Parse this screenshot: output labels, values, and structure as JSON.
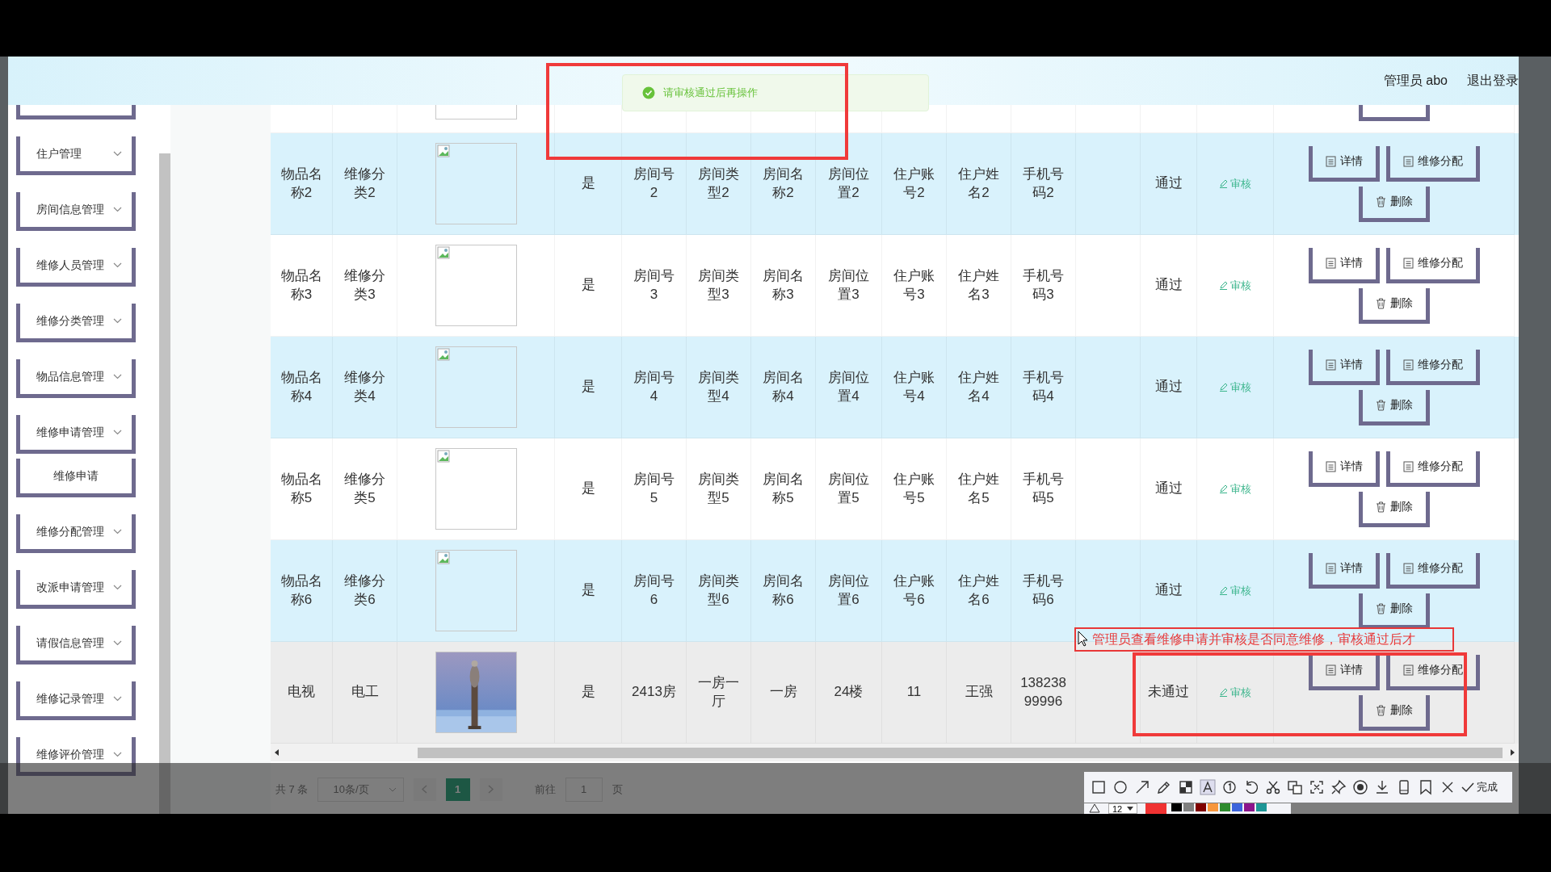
{
  "header": {
    "user": "管理员 abo",
    "logout": "退出登录"
  },
  "toast": {
    "message": "请审核通过后再操作"
  },
  "sidebar": {
    "items": [
      {
        "label": "住户管理",
        "kind": "group"
      },
      {
        "label": "房间信息管理",
        "kind": "group"
      },
      {
        "label": "维修人员管理",
        "kind": "group"
      },
      {
        "label": "维修分类管理",
        "kind": "group"
      },
      {
        "label": "物品信息管理",
        "kind": "group"
      },
      {
        "label": "维修申请管理",
        "kind": "group"
      },
      {
        "label": "维修申请",
        "kind": "sub"
      },
      {
        "label": "维修分配管理",
        "kind": "group"
      },
      {
        "label": "改派申请管理",
        "kind": "group"
      },
      {
        "label": "请假信息管理",
        "kind": "group"
      },
      {
        "label": "维修记录管理",
        "kind": "group"
      },
      {
        "label": "维修评价管理",
        "kind": "group"
      }
    ]
  },
  "table": {
    "rows": [
      {
        "cells": [
          "物品名称2",
          "维修分类2"
        ],
        "image": {
          "kind": "broken"
        },
        "details": [
          "是",
          "房间号2",
          "房间类型2",
          "房间名称2",
          "房间位置2",
          "住户账号2",
          "住户姓名2",
          "手机号码2"
        ],
        "status": "通过",
        "audit": "审核",
        "actions": [
          "详情",
          "维修分配",
          "删除"
        ],
        "hovered": false
      },
      {
        "cells": [
          "物品名称3",
          "维修分类3"
        ],
        "image": {
          "kind": "broken"
        },
        "details": [
          "是",
          "房间号3",
          "房间类型3",
          "房间名称3",
          "房间位置3",
          "住户账号3",
          "住户姓名3",
          "手机号码3"
        ],
        "status": "通过",
        "audit": "审核",
        "actions": [
          "详情",
          "维修分配",
          "删除"
        ],
        "hovered": false
      },
      {
        "cells": [
          "物品名称4",
          "维修分类4"
        ],
        "image": {
          "kind": "broken"
        },
        "details": [
          "是",
          "房间号4",
          "房间类型4",
          "房间名称4",
          "房间位置4",
          "住户账号4",
          "住户姓名4",
          "手机号码4"
        ],
        "status": "通过",
        "audit": "审核",
        "actions": [
          "详情",
          "维修分配",
          "删除"
        ],
        "hovered": false
      },
      {
        "cells": [
          "物品名称5",
          "维修分类5"
        ],
        "image": {
          "kind": "broken"
        },
        "details": [
          "是",
          "房间号5",
          "房间类型5",
          "房间名称5",
          "房间位置5",
          "住户账号5",
          "住户姓名5",
          "手机号码5"
        ],
        "status": "通过",
        "audit": "审核",
        "actions": [
          "详情",
          "维修分配",
          "删除"
        ],
        "hovered": false
      },
      {
        "cells": [
          "物品名称6",
          "维修分类6"
        ],
        "image": {
          "kind": "broken"
        },
        "details": [
          "是",
          "房间号6",
          "房间类型6",
          "房间名称6",
          "房间位置6",
          "住户账号6",
          "住户姓名6",
          "手机号码6"
        ],
        "status": "通过",
        "audit": "审核",
        "actions": [
          "详情",
          "维修分配",
          "删除"
        ],
        "hovered": false
      },
      {
        "cells": [
          "电视",
          "电工"
        ],
        "image": {
          "kind": "picture"
        },
        "details": [
          "是",
          "2413房",
          "一房一厅",
          "一房",
          "24楼",
          "11",
          "王强",
          "13823899996"
        ],
        "status": "未通过",
        "audit": "审核",
        "actions": [
          "详情",
          "维修分配",
          "删除"
        ],
        "hovered": true
      }
    ]
  },
  "pagination": {
    "total": "共 7 条",
    "page_size": "10条/页",
    "current_page": "1",
    "goto_label": "前往",
    "goto_value": "1",
    "goto_suffix": "页"
  },
  "annotation": {
    "note": "管理员查看维修申请并审核是否同意维修，审核通过后才"
  },
  "toolbar": {
    "done": "完成",
    "font_size": "12",
    "swatches": [
      {
        "color": "#f03232",
        "selected": true
      },
      {
        "color": "#000000",
        "selected": false
      },
      {
        "color": "#808080",
        "selected": false
      },
      {
        "color": "#800000",
        "selected": false
      },
      {
        "color": "#f7963c",
        "selected": false
      },
      {
        "color": "#2e8b2e",
        "selected": false
      },
      {
        "color": "#3c64dc",
        "selected": false
      },
      {
        "color": "#8c148c",
        "selected": false
      },
      {
        "color": "#1e9696",
        "selected": false
      }
    ]
  }
}
